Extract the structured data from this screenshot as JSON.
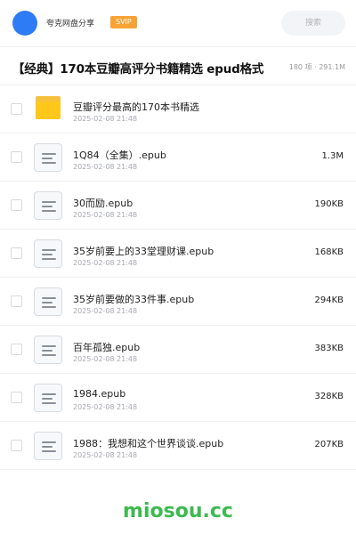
{
  "header": {
    "brand": "夸克网盘分享",
    "badge": "SVIP",
    "search_placeholder": "搜索",
    "accent_color": "#2e7bf6",
    "badge_color": "#f7a334"
  },
  "page": {
    "title": "【经典】170本豆瓣高评分书籍精选 epud格式",
    "meta": "180 项 · 291.1M"
  },
  "files": [
    {
      "type": "folder",
      "icon": "folder-icon",
      "name": "豆瓣评分最高的170本书精选",
      "date": "2025-02-08 21:48",
      "size": ""
    },
    {
      "type": "file",
      "icon": "document-icon",
      "name": "1Q84（全集）.epub",
      "date": "2025-02-08 21:48",
      "size": "1.3M"
    },
    {
      "type": "file",
      "icon": "document-icon",
      "name": "30而励.epub",
      "date": "2025-02-08 21:48",
      "size": "190KB"
    },
    {
      "type": "file",
      "icon": "document-icon",
      "name": "35岁前要上的33堂理财课.epub",
      "date": "2025-02-08 21:48",
      "size": "168KB"
    },
    {
      "type": "file",
      "icon": "document-icon",
      "name": "35岁前要做的33件事.epub",
      "date": "2025-02-08 21:48",
      "size": "294KB"
    },
    {
      "type": "file",
      "icon": "document-icon",
      "name": "百年孤独.epub",
      "date": "2025-02-08 21:48",
      "size": "383KB"
    },
    {
      "type": "file",
      "icon": "document-icon",
      "name": "1984.epub",
      "date": "2025-02-08 21:48",
      "size": "328KB"
    },
    {
      "type": "file",
      "icon": "document-icon",
      "name": "1988：我想和这个世界谈谈.epub",
      "date": "2025-02-08 21:48",
      "size": "207KB"
    }
  ],
  "watermark": {
    "text": "miosou.cc",
    "color": "#3cba4f"
  }
}
